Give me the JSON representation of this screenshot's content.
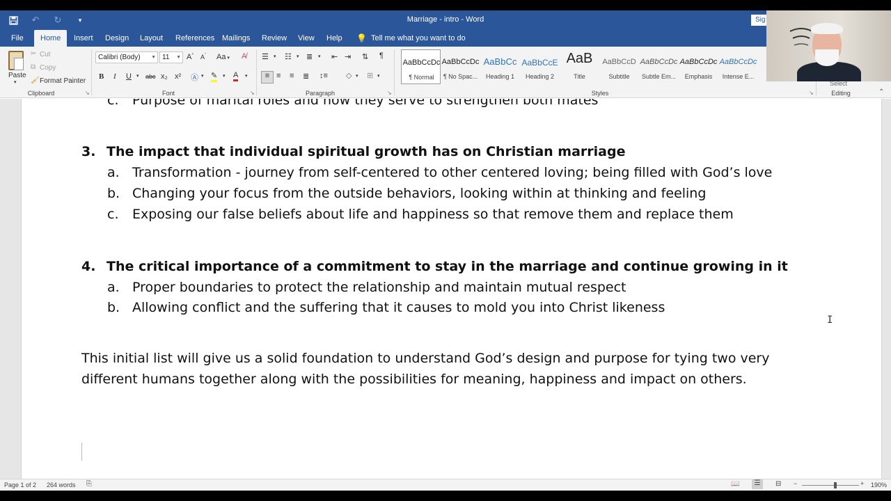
{
  "window": {
    "title": "Marriage - intro - Word",
    "signin": "Sig"
  },
  "qat": {
    "save_icon": "save-icon",
    "undo_icon": "undo-icon",
    "redo_icon": "redo-icon",
    "customize_icon": "customize-qat-icon"
  },
  "tabs": [
    "File",
    "Home",
    "Insert",
    "Design",
    "Layout",
    "References",
    "Mailings",
    "Review",
    "View",
    "Help"
  ],
  "tell_me": "Tell me what you want to do",
  "ribbon": {
    "clipboard": {
      "label": "Clipboard",
      "paste": "Paste",
      "cut": "Cut",
      "copy": "Copy",
      "format_painter": "Format Painter"
    },
    "font": {
      "label": "Font",
      "family": "Calibri (Body)",
      "size": "11",
      "case": "Aa",
      "bold": "B",
      "italic": "I",
      "underline": "U",
      "strike": "abc",
      "subscript": "x₂",
      "superscript": "x²",
      "font_color": "A"
    },
    "paragraph": {
      "label": "Paragraph"
    },
    "styles": {
      "label": "Styles",
      "items": [
        {
          "sample": "AaBbCcDc",
          "name": "¶ Normal"
        },
        {
          "sample": "AaBbCcDc",
          "name": "¶ No Spac..."
        },
        {
          "sample": "AaBbCc",
          "name": "Heading 1"
        },
        {
          "sample": "AaBbCcE",
          "name": "Heading 2"
        },
        {
          "sample": "AaB",
          "name": "Title"
        },
        {
          "sample": "AaBbCcD",
          "name": "Subtitle"
        },
        {
          "sample": "AaBbCcDc",
          "name": "Subtle Em..."
        },
        {
          "sample": "AaBbCcDc",
          "name": "Emphasis"
        },
        {
          "sample": "AaBbCcDc",
          "name": "Intense E..."
        }
      ]
    },
    "editing": {
      "label": "Editing",
      "select": "Select"
    }
  },
  "document": {
    "lines": [
      {
        "marker": "c.",
        "text": "Purpose of marital roles and how they serve to strengthen both mates"
      },
      {
        "marker": "3.",
        "text": "The impact that individual spiritual growth has on Christian marriage"
      },
      {
        "marker": "a.",
        "text": "Transformation - journey from self-centered to other centered loving; being filled with God’s love"
      },
      {
        "marker": "b.",
        "text": "Changing your focus from the outside behaviors, looking within at thinking and feeling"
      },
      {
        "marker": "c.",
        "text": "Exposing our false beliefs about life and happiness so that remove them and replace them"
      },
      {
        "marker": "4.",
        "text": "The critical importance of a commitment to stay in the marriage and continue growing in it"
      },
      {
        "marker": "a.",
        "text": "Proper boundaries to protect the relationship and maintain mutual respect"
      },
      {
        "marker": "b.",
        "text": "Allowing conflict and the suffering that it causes to mold you into Christ likeness"
      }
    ],
    "paragraph": [
      "This initial list will give us a solid foundation to understand God’s design and purpose for tying two very",
      "different humans together along with the possibilities for meaning, happiness and impact on others."
    ]
  },
  "status": {
    "page": "Page 1 of 2",
    "words": "264 words",
    "zoom": "190%"
  },
  "colors": {
    "word_blue": "#2b579a"
  }
}
